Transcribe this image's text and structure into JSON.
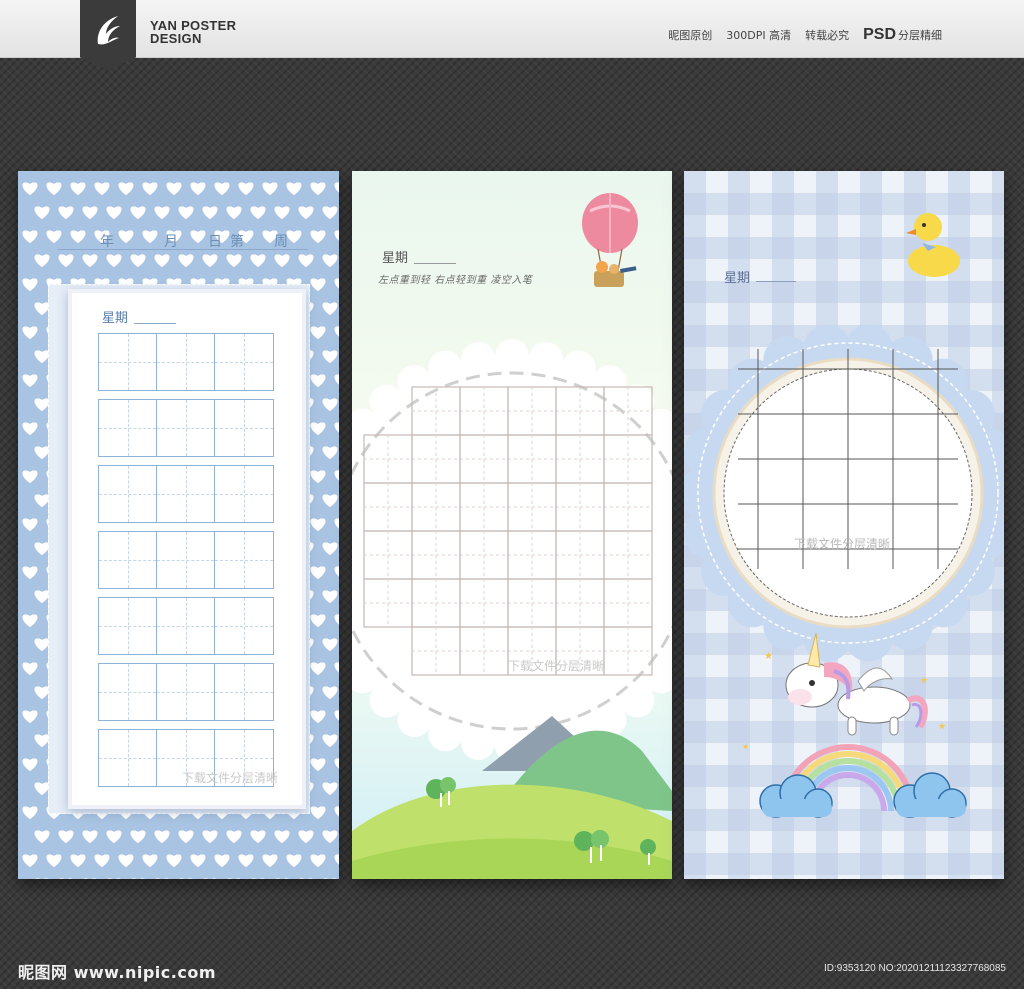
{
  "header": {
    "brand_line1": "YAN POSTER",
    "brand_line2": "DESIGN",
    "nav": [
      "昵图原创",
      "300DPI 高清",
      "转载必究"
    ],
    "psd_tag": "PSD",
    "psd_text": "分层精细"
  },
  "panel1": {
    "date_labels": [
      "年",
      "月",
      "日",
      "第",
      "周"
    ],
    "weekday_label": "星期",
    "watermark": "下载文件分层清晰"
  },
  "panel2": {
    "weekday_label": "星期",
    "motto": "左点重到轻  右点轻到重  凌空入笔",
    "watermark": "下载文件分层清晰"
  },
  "panel3": {
    "weekday_label": "星期",
    "watermark": "下载文件分层清晰"
  },
  "footer": {
    "site": "昵图网 www.nipic.com",
    "id_text": "ID:9353120 NO:20201211123327768085"
  },
  "colors": {
    "panel1_bg": "#a9c4e2",
    "grid_blue": "#8fb3d8",
    "panel2_grid": "#c4b9b4",
    "panel3_frame": "#b9cdea"
  }
}
